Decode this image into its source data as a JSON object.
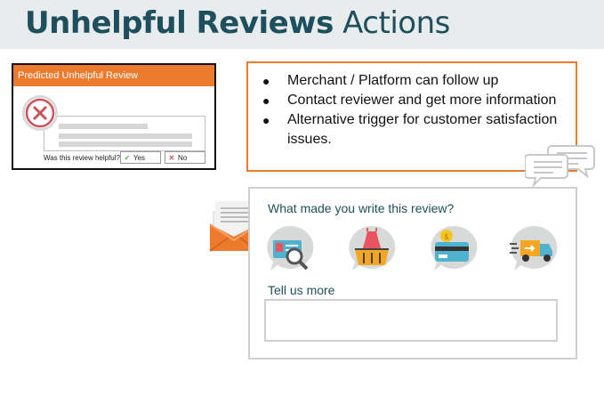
{
  "title": {
    "bold": "Unhelpful Reviews",
    "light": "Actions"
  },
  "review_card": {
    "header": "Predicted Unhelpful Review",
    "question": "Was this review helpful?",
    "yes_label": "Yes",
    "no_label": "No"
  },
  "bullets": [
    "Merchant / Platform can follow up",
    "Contact reviewer and get more information",
    "Alternative trigger for customer satisfaction issues."
  ],
  "survey": {
    "question": "What made you write this review?",
    "tell_us_more": "Tell us more",
    "options": [
      "product-icon",
      "basket-icon",
      "payment-icon",
      "delivery-icon"
    ]
  },
  "colors": {
    "accent": "#ee7b2d",
    "title": "#1d4f5e",
    "icon_bg": "#d8dada"
  }
}
